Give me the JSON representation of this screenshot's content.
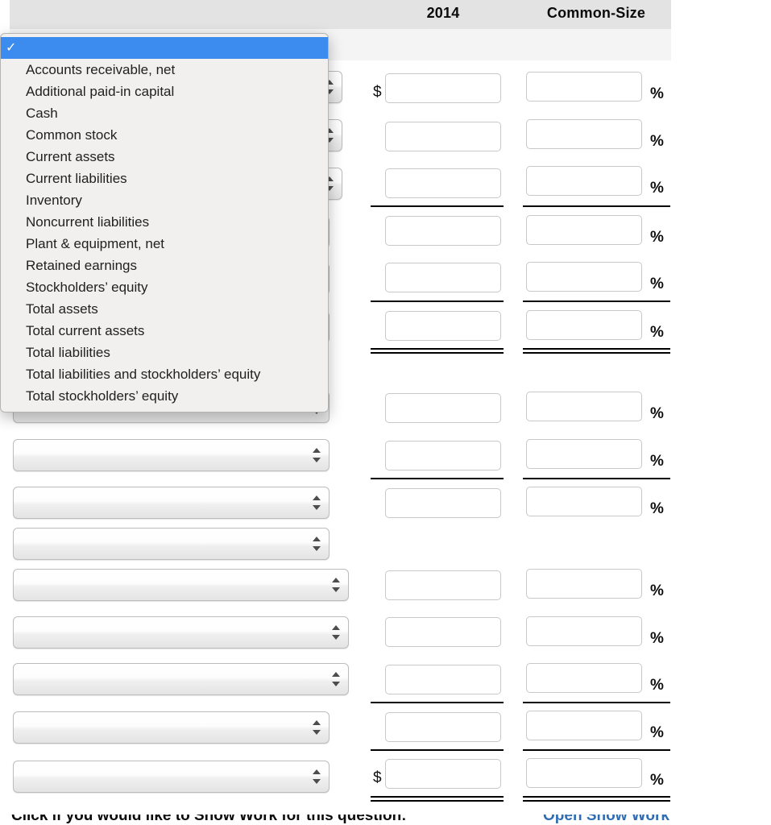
{
  "table": {
    "columns": {
      "year_label": "2014",
      "common_size_label": "Common-Size"
    },
    "currency_symbol": "$",
    "percent_symbol": "%"
  },
  "dropdown": {
    "selected_value": "",
    "selected_check_glyph": "✓",
    "options": [
      "Accounts receivable, net",
      "Additional paid-in capital",
      "Cash",
      "Common stock",
      "Current assets",
      "Current liabilities",
      "Inventory",
      "Noncurrent liabilities",
      "Plant & equipment, net",
      "Retained earnings",
      "Stockholders’ equity",
      "Total assets",
      "Total current assets",
      "Total liabilities",
      "Total liabilities and stockholders’ equity",
      "Total stockholders’ equity"
    ]
  },
  "rows": [
    {
      "select_value": "",
      "amount": "",
      "percent": ""
    },
    {
      "select_value": "",
      "amount": "",
      "percent": ""
    },
    {
      "select_value": "",
      "amount": "",
      "percent": ""
    },
    {
      "select_value": "",
      "amount": "",
      "percent": ""
    },
    {
      "select_value": "",
      "amount": "",
      "percent": ""
    },
    {
      "select_value": "",
      "amount": "",
      "percent": ""
    },
    {
      "select_value": "",
      "amount": "",
      "percent": ""
    },
    {
      "select_value": "",
      "amount": "",
      "percent": ""
    },
    {
      "select_value": "",
      "amount": "",
      "percent": ""
    },
    {
      "select_value": "",
      "amount": "",
      "percent": ""
    },
    {
      "select_value": "",
      "amount": "",
      "percent": ""
    },
    {
      "select_value": "",
      "amount": "",
      "percent": ""
    },
    {
      "select_value": "",
      "amount": "",
      "percent": ""
    },
    {
      "select_value": "",
      "amount": "",
      "percent": ""
    },
    {
      "select_value": "",
      "amount": "",
      "percent": ""
    }
  ],
  "footer": {
    "prompt": "Click if you would like to Show Work for this question:",
    "link": "Open Show Work"
  },
  "colors": {
    "header_band": "#e3e3e3",
    "subheader_band": "#f4f4f4",
    "menu_highlight": "#3c8cf0",
    "link": "#2e6db4"
  }
}
